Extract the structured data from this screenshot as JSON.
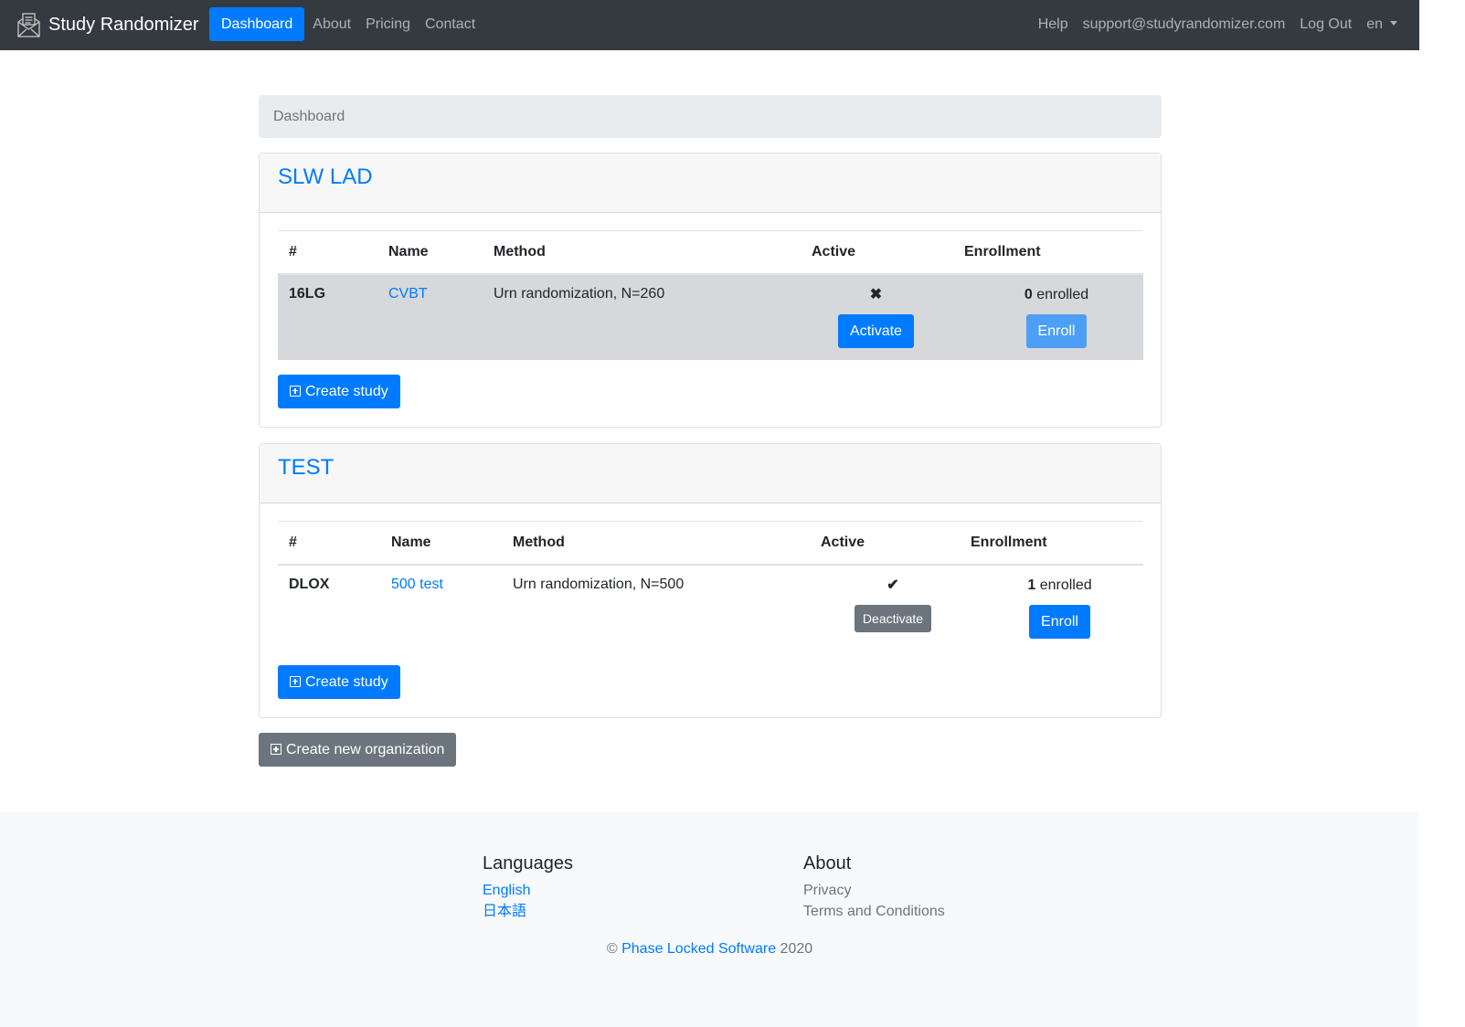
{
  "navbar": {
    "brand": "Study Randomizer",
    "logo_icon": "envelope-document-icon",
    "links": [
      "Dashboard",
      "About",
      "Pricing",
      "Contact"
    ],
    "active": "Dashboard",
    "right": {
      "help": "Help",
      "email": "support@studyrandomizer.com",
      "logout": "Log Out",
      "language": "en"
    }
  },
  "breadcrumb": "Dashboard",
  "columns": {
    "id": "#",
    "name": "Name",
    "method": "Method",
    "active": "Active",
    "enrollment": "Enrollment"
  },
  "organizations": [
    {
      "name": "SLW LAD",
      "studies": [
        {
          "id": "16LG",
          "name": "CVBT",
          "method": "Urn randomization, N=260",
          "active_icon": "x-icon",
          "active_symbol": "✖",
          "toggle_label": "Activate",
          "enrolled_count": "0",
          "enrolled_label": "enrolled",
          "enroll_label": "Enroll"
        }
      ],
      "create_label": "Create study"
    },
    {
      "name": "TEST",
      "studies": [
        {
          "id": "DLOX",
          "name": "500 test",
          "method": "Urn randomization, N=500",
          "active_icon": "check-icon",
          "active_symbol": "✔",
          "toggle_label": "Deactivate",
          "enrolled_count": "1",
          "enrolled_label": "enrolled",
          "enroll_label": "Enroll"
        }
      ],
      "create_label": "Create study"
    }
  ],
  "create_org_label": "Create new organization",
  "footer": {
    "languages_title": "Languages",
    "languages": [
      "English",
      "日本語"
    ],
    "about_title": "About",
    "about_links": [
      "Privacy",
      "Terms and Conditions"
    ],
    "copyright_symbol": "©",
    "company": "Phase Locked Software",
    "year": "2020"
  },
  "colors": {
    "navbar": "#343a40",
    "primary": "#007bff",
    "secondary": "#6c757d",
    "breadcrumb": "#e9ecef",
    "highlight_row": "#d6d8db",
    "footer": "#f8f9fa"
  }
}
